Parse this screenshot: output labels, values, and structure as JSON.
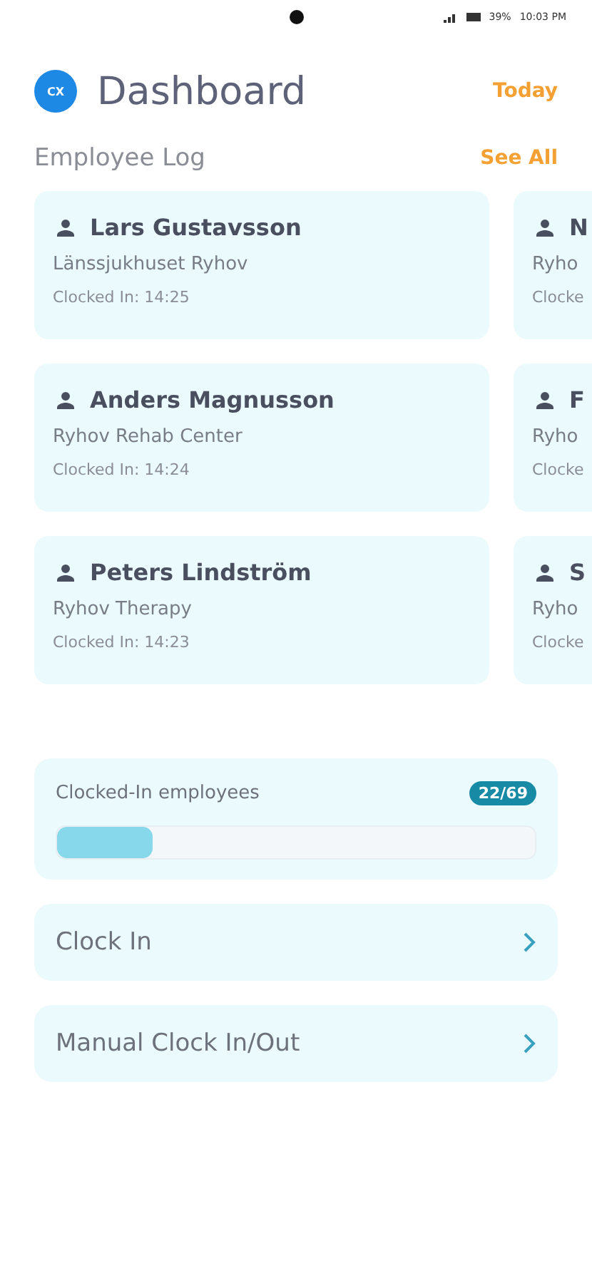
{
  "status_bar": {
    "battery": "39%",
    "time": "10:03 PM"
  },
  "header": {
    "avatar": "CX",
    "title": "Dashboard",
    "action": "Today"
  },
  "section": {
    "title": "Employee Log",
    "action": "See All"
  },
  "employee_rows": [
    [
      {
        "name": "Lars Gustavsson",
        "place": "Länssjukhuset Ryhov",
        "clocked": "Clocked In: 14:25"
      },
      {
        "name": "N",
        "place": "Ryho",
        "clocked": "Clocke"
      }
    ],
    [
      {
        "name": "Anders Magnusson",
        "place": "Ryhov Rehab Center",
        "clocked": "Clocked In: 14:24"
      },
      {
        "name": "F",
        "place": "Ryho",
        "clocked": "Clocke"
      }
    ],
    [
      {
        "name": "Peters Lindström",
        "place": "Ryhov Therapy",
        "clocked": "Clocked In: 14:23"
      },
      {
        "name": "S",
        "place": "Ryho",
        "clocked": "Clocke"
      }
    ]
  ],
  "progress": {
    "label": "Clocked-In employees",
    "count": "22/69",
    "level": 0.2
  },
  "actions": [
    {
      "label": "Clock In"
    },
    {
      "label": "Manual Clock In/Out"
    }
  ]
}
